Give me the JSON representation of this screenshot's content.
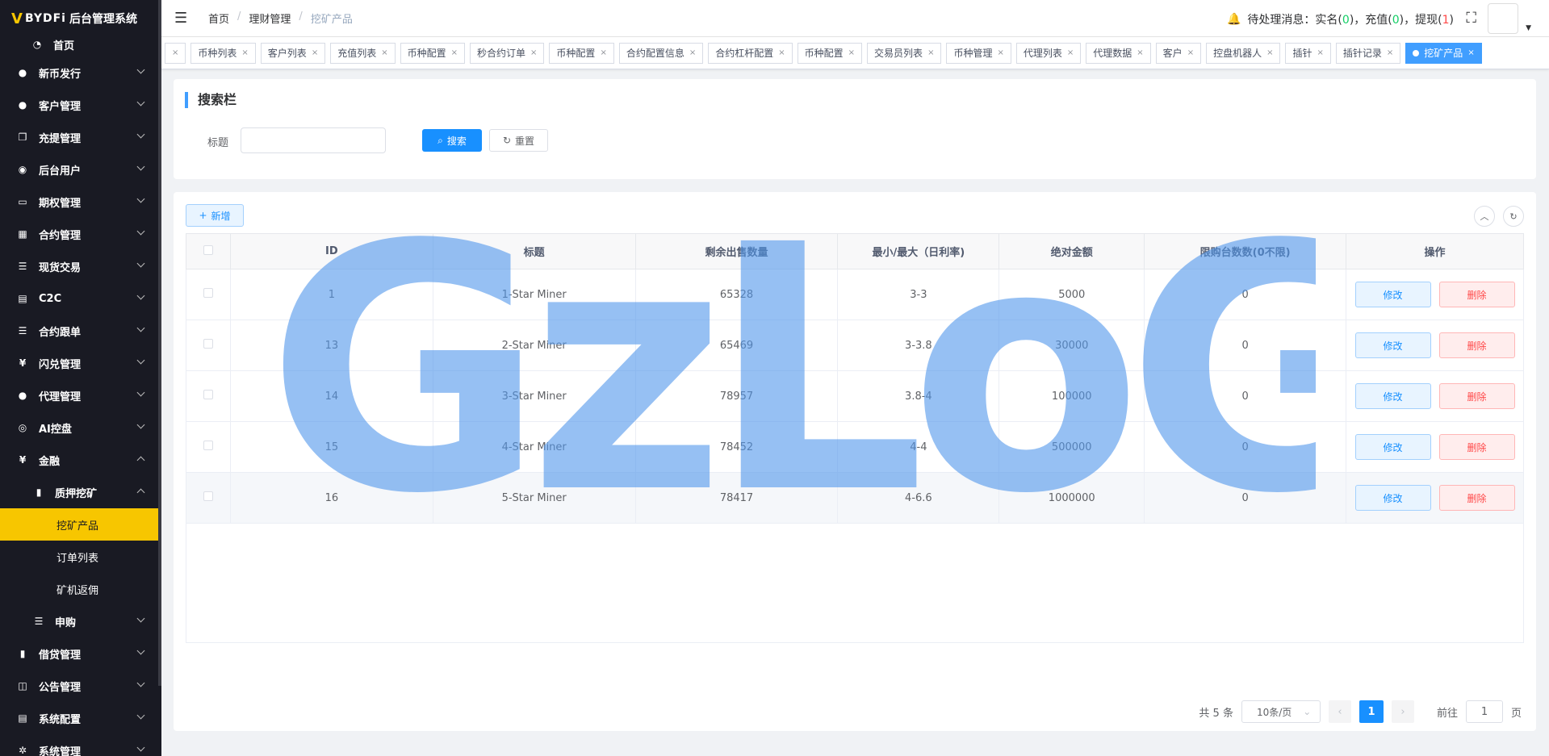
{
  "app": {
    "brand_mark": "V",
    "brand": "BYDFi",
    "system": "后台管理系统"
  },
  "menu": [
    {
      "label": "首页",
      "icon": "dashboard-icon",
      "type": "home"
    },
    {
      "label": "新币发行",
      "icon": "user-icon"
    },
    {
      "label": "客户管理",
      "icon": "user-icon"
    },
    {
      "label": "充提管理",
      "icon": "copy-icon"
    },
    {
      "label": "后台用户",
      "icon": "users-icon"
    },
    {
      "label": "期权管理",
      "icon": "monitor-icon"
    },
    {
      "label": "合约管理",
      "icon": "grid-icon"
    },
    {
      "label": "现货交易",
      "icon": "list-icon"
    },
    {
      "label": "C2C",
      "icon": "document-icon"
    },
    {
      "label": "合约跟单",
      "icon": "list-icon"
    },
    {
      "label": "闪兑管理",
      "icon": "yen-icon"
    },
    {
      "label": "代理管理",
      "icon": "user-icon"
    },
    {
      "label": "AI控盘",
      "icon": "robot-icon"
    },
    {
      "label": "金融",
      "icon": "yen-icon",
      "expanded": true
    },
    {
      "label": "质押挖矿",
      "icon": "bar-chart-icon",
      "type": "sub",
      "expanded": true
    },
    {
      "label": "挖矿产品",
      "type": "leaf",
      "active": true
    },
    {
      "label": "订单列表",
      "type": "leaf"
    },
    {
      "label": "矿机返佣",
      "type": "leaf"
    },
    {
      "label": "申购",
      "icon": "list-icon",
      "type": "sub"
    },
    {
      "label": "借贷管理",
      "icon": "book-icon"
    },
    {
      "label": "公告管理",
      "icon": "book-open-icon"
    },
    {
      "label": "系统配置",
      "icon": "document-icon"
    },
    {
      "label": "系统管理",
      "icon": "gear-icon"
    }
  ],
  "header": {
    "breadcrumb": [
      "首页",
      "理财管理",
      "挖矿产品"
    ],
    "notice_label": "待处理消息：",
    "notice_items": [
      {
        "label": "实名(",
        "count": "0",
        "suffix": ")，",
        "color": "g"
      },
      {
        "label": "充值(",
        "count": "0",
        "suffix": ")，",
        "color": "g"
      },
      {
        "label": "提现(",
        "count": "1",
        "suffix": ")",
        "color": "r"
      }
    ]
  },
  "tags": [
    "币种列表",
    "客户列表",
    "充值列表",
    "币种配置",
    "秒合约订单",
    "币种配置",
    "合约配置信息",
    "合约杠杆配置",
    "币种配置",
    "交易员列表",
    "币种管理",
    "代理列表",
    "代理数据",
    "客户",
    "控盘机器人",
    "插针",
    "插针记录",
    "挖矿产品"
  ],
  "active_tag": "挖矿产品",
  "search": {
    "title": "搜索栏",
    "field_label": "标题",
    "field_value": "",
    "search_label": "搜索",
    "reset_label": "重置"
  },
  "toolbar": {
    "add_label": "新增"
  },
  "table": {
    "columns": [
      "ID",
      "标题",
      "剩余出售数量",
      "最小/最大（日利率)",
      "绝对金额",
      "限购台数数(0不限)",
      "操作"
    ],
    "rows": [
      {
        "id": "1",
        "title": "1-Star Miner",
        "remain": "65328",
        "rate": "3-3",
        "amount": "5000",
        "limit": "0"
      },
      {
        "id": "13",
        "title": "2-Star Miner",
        "remain": "65469",
        "rate": "3-3.8",
        "amount": "30000",
        "limit": "0"
      },
      {
        "id": "14",
        "title": "3-Star Miner",
        "remain": "78957",
        "rate": "3.8-4",
        "amount": "100000",
        "limit": "0"
      },
      {
        "id": "15",
        "title": "4-Star Miner",
        "remain": "78452",
        "rate": "4-4",
        "amount": "500000",
        "limit": "0"
      },
      {
        "id": "16",
        "title": "5-Star Miner",
        "remain": "78417",
        "rate": "4-6.6",
        "amount": "1000000",
        "limit": "0"
      }
    ],
    "edit_label": "修改",
    "delete_label": "删除"
  },
  "pagination": {
    "total": "共 5 条",
    "page_size": "10条/页",
    "current": "1",
    "goto_label": "前往",
    "goto_value": "1",
    "page_suffix": "页"
  },
  "watermark": "GzLoG"
}
